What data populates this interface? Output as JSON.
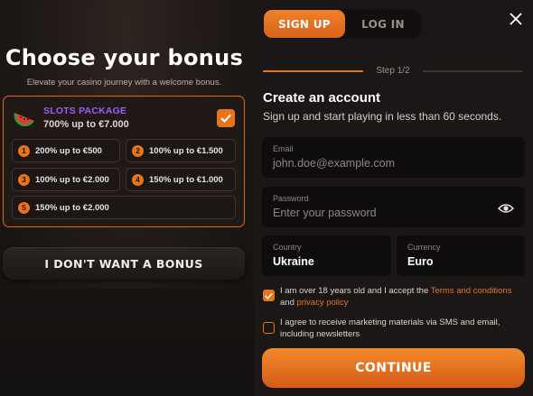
{
  "bonus": {
    "title": "Choose your bonus",
    "subtitle": "Elevate your casino journey with a welcome bonus.",
    "package": {
      "name": "SLOTS PACKAGE",
      "offer": "700% up to €7.000",
      "icon": "watermelon-icon",
      "selected": true
    },
    "offers": [
      {
        "num": "1",
        "label": "200% up to €500"
      },
      {
        "num": "2",
        "label": "100% up to €1.500"
      },
      {
        "num": "3",
        "label": "100% up to €2.000"
      },
      {
        "num": "4",
        "label": "150% up to €1.000"
      },
      {
        "num": "5",
        "label": "150% up to €2.000"
      }
    ],
    "no_bonus_label": "I DON'T WANT A BONUS"
  },
  "tabs": {
    "signup": "SIGN UP",
    "login": "LOG IN",
    "active": "signup"
  },
  "step": {
    "label": "Step 1/2",
    "current": 1,
    "total": 2
  },
  "form": {
    "title": "Create an account",
    "subtitle": "Sign up and start playing in less than 60 seconds.",
    "email": {
      "label": "Email",
      "placeholder": "john.doe@example.com"
    },
    "password": {
      "label": "Password",
      "placeholder": "Enter your password"
    },
    "country": {
      "label": "Country",
      "value": "Ukraine"
    },
    "currency": {
      "label": "Currency",
      "value": "Euro"
    },
    "age_consent": {
      "checked": true,
      "text_before": "I am over 18 years old and I accept the ",
      "terms_link": "Terms and conditions",
      "text_and": "and ",
      "privacy_link": "privacy policy"
    },
    "marketing_consent": {
      "checked": false,
      "line1": "I agree to receive marketing materials via SMS and email,",
      "line2": "including newsletters"
    },
    "continue_label": "CONTINUE"
  },
  "colors": {
    "accent": "#e8751c",
    "package_name": "#9b5cff",
    "link": "#ee7322",
    "panel_bg": "#1a1716",
    "field_bg": "#0e0c0c"
  }
}
